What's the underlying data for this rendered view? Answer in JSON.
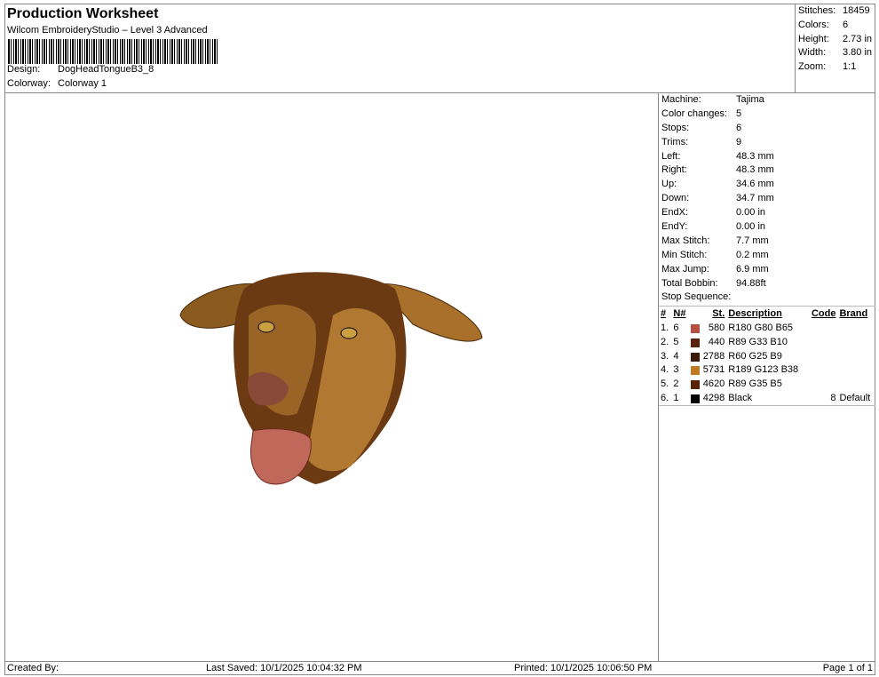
{
  "header": {
    "title": "Production Worksheet",
    "subtitle": "Wilcom EmbroideryStudio – Level 3 Advanced",
    "design_label": "Design:",
    "design": "DogHeadTongueB3_8",
    "colorway_label": "Colorway:",
    "colorway": "Colorway 1"
  },
  "summary": [
    {
      "k": "Stitches:",
      "v": "18459"
    },
    {
      "k": "Colors:",
      "v": "6"
    },
    {
      "k": "Height:",
      "v": "2.73 in"
    },
    {
      "k": "Width:",
      "v": "3.80 in"
    },
    {
      "k": "Zoom:",
      "v": "1:1"
    }
  ],
  "details": [
    {
      "k": "Machine:",
      "v": "Tajima"
    },
    {
      "k": "Color changes:",
      "v": "5"
    },
    {
      "k": "Stops:",
      "v": "6"
    },
    {
      "k": "Trims:",
      "v": "9"
    },
    {
      "k": "Left:",
      "v": "48.3 mm"
    },
    {
      "k": "Right:",
      "v": "48.3 mm"
    },
    {
      "k": "Up:",
      "v": "34.6 mm"
    },
    {
      "k": "Down:",
      "v": "34.7 mm"
    },
    {
      "k": "EndX:",
      "v": "0.00 in"
    },
    {
      "k": "EndY:",
      "v": "0.00 in"
    },
    {
      "k": "Max Stitch:",
      "v": "7.7 mm"
    },
    {
      "k": "Min Stitch:",
      "v": "0.2 mm"
    },
    {
      "k": "Max Jump:",
      "v": "6.9 mm"
    },
    {
      "k": "Total Bobbin:",
      "v": "94.88ft"
    }
  ],
  "stop_sequence": {
    "label": "Stop Sequence:",
    "headers": [
      "#",
      "N#",
      "St.",
      "Description",
      "Code",
      "Brand"
    ],
    "rows": [
      {
        "num": "1.",
        "n": "6",
        "color": "#b45041",
        "st": "580",
        "desc": "R180 G80 B65",
        "code": "",
        "brand": ""
      },
      {
        "num": "2.",
        "n": "5",
        "color": "#59210a",
        "st": "440",
        "desc": "R89 G33 B10",
        "code": "",
        "brand": ""
      },
      {
        "num": "3.",
        "n": "4",
        "color": "#3c1909",
        "st": "2788",
        "desc": "R60 G25 B9",
        "code": "",
        "brand": ""
      },
      {
        "num": "4.",
        "n": "3",
        "color": "#bd7b26",
        "st": "5731",
        "desc": "R189 G123 B38",
        "code": "",
        "brand": ""
      },
      {
        "num": "5.",
        "n": "2",
        "color": "#592305",
        "st": "4620",
        "desc": "R89 G35 B5",
        "code": "",
        "brand": ""
      },
      {
        "num": "6.",
        "n": "1",
        "color": "#000000",
        "st": "4298",
        "desc": "Black",
        "code": "8",
        "brand": "Default"
      }
    ]
  },
  "footer": {
    "created": "Created By:",
    "saved": "Last Saved: 10/1/2025 10:04:32 PM",
    "printed": "Printed: 10/1/2025 10:06:50 PM",
    "page": "Page 1 of 1"
  }
}
